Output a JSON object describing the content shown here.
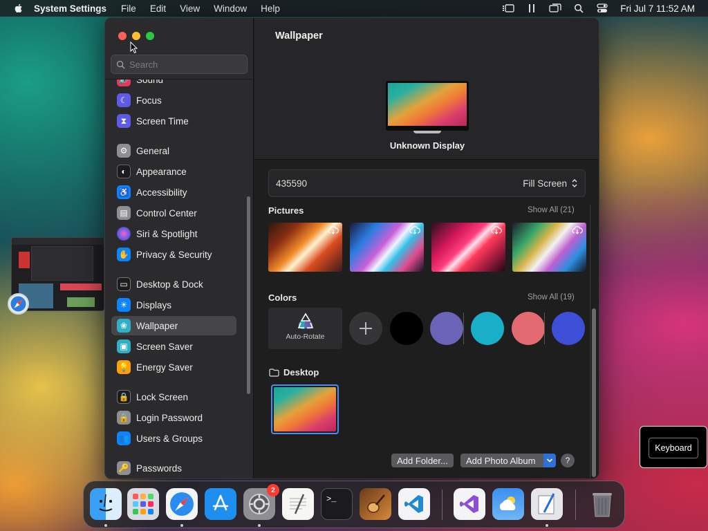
{
  "menubar": {
    "app_name": "System Settings",
    "menus": [
      "File",
      "Edit",
      "View",
      "Window",
      "Help"
    ],
    "clock": "Fri Jul 7  11:52 AM"
  },
  "sidebar": {
    "search_placeholder": "Search",
    "items": [
      {
        "label": "Sound",
        "icon": "speaker-icon",
        "color": "#e5395a"
      },
      {
        "label": "Focus",
        "icon": "moon-icon",
        "color": "#5e5ce6"
      },
      {
        "label": "Screen Time",
        "icon": "hourglass-icon",
        "color": "#5e5ce6"
      },
      {
        "label": "General",
        "icon": "gear-icon",
        "color": "#8e8e93"
      },
      {
        "label": "Appearance",
        "icon": "appearance-icon",
        "color": "#1c1c1e"
      },
      {
        "label": "Accessibility",
        "icon": "accessibility-icon",
        "color": "#0a84ff"
      },
      {
        "label": "Control Center",
        "icon": "toggles-icon",
        "color": "#8e8e93"
      },
      {
        "label": "Siri & Spotlight",
        "icon": "siri-icon",
        "color": "#bf5af2"
      },
      {
        "label": "Privacy & Security",
        "icon": "hand-icon",
        "color": "#0a84ff"
      },
      {
        "label": "Desktop & Dock",
        "icon": "dock-icon",
        "color": "#1c1c1e"
      },
      {
        "label": "Displays",
        "icon": "sun-icon",
        "color": "#0a84ff"
      },
      {
        "label": "Wallpaper",
        "icon": "flower-icon",
        "color": "#30b0c7"
      },
      {
        "label": "Screen Saver",
        "icon": "screensaver-icon",
        "color": "#30b0c7"
      },
      {
        "label": "Energy Saver",
        "icon": "bulb-icon",
        "color": "#ff9f0a"
      },
      {
        "label": "Lock Screen",
        "icon": "lock-icon",
        "color": "#1c1c1e"
      },
      {
        "label": "Login Password",
        "icon": "lock-icon",
        "color": "#8e8e93"
      },
      {
        "label": "Users & Groups",
        "icon": "users-icon",
        "color": "#0a84ff"
      },
      {
        "label": "Passwords",
        "icon": "key-icon",
        "color": "#8e8e93"
      }
    ],
    "selected": "Wallpaper"
  },
  "content": {
    "title": "Wallpaper",
    "display_name": "Unknown Display",
    "wallpaper_name": "435590",
    "fill_mode": "Fill Screen",
    "pictures": {
      "label": "Pictures",
      "show_all": "Show All (21)"
    },
    "colors": {
      "label": "Colors",
      "show_all": "Show All (19)",
      "auto_rotate": "Auto-Rotate",
      "swatches": [
        "#000000",
        "#6b63b5",
        "#1aafc9",
        "#e46a72",
        "#3d4fd6"
      ]
    },
    "desktop": {
      "label": "Desktop"
    },
    "buttons": {
      "add_folder": "Add Folder...",
      "add_photo_album": "Add Photo Album",
      "help": "?"
    }
  },
  "tooltip": {
    "label": "Keyboard"
  },
  "dock": {
    "settings_badge": "2",
    "apps": [
      "finder-icon",
      "launchpad-icon",
      "safari-icon",
      "app-store-icon",
      "system-settings-icon",
      "textedit-icon",
      "terminal-icon",
      "garageband-icon",
      "vscode-icon",
      "visual-studio-icon",
      "weather-icon",
      "script-editor-icon",
      "trash-icon"
    ]
  }
}
